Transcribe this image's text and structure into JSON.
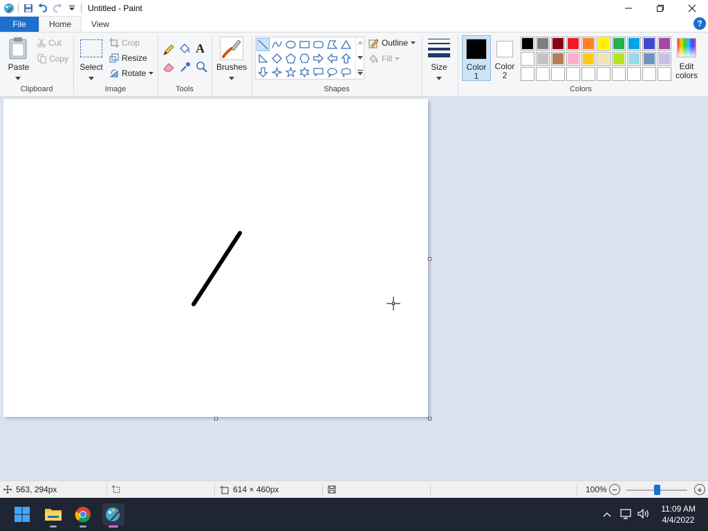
{
  "window": {
    "title": "Untitled - Paint"
  },
  "tabs": [
    {
      "label": "File"
    },
    {
      "label": "Home"
    },
    {
      "label": "View"
    }
  ],
  "help": {
    "label": "?"
  },
  "clipboard": {
    "group_label": "Clipboard",
    "paste_label": "Paste",
    "cut_label": "Cut",
    "copy_label": "Copy"
  },
  "image": {
    "group_label": "Image",
    "select_label": "Select",
    "crop_label": "Crop",
    "resize_label": "Resize",
    "rotate_label": "Rotate"
  },
  "tools": {
    "group_label": "Tools",
    "text_tool_glyph": "A"
  },
  "brushes": {
    "label": "Brushes"
  },
  "shapes": {
    "group_label": "Shapes",
    "outline_label": "Outline",
    "fill_label": "Fill",
    "selected": "line"
  },
  "size": {
    "label": "Size"
  },
  "colors": {
    "group_label": "Colors",
    "color1_label": "Color",
    "color1_num": "1",
    "color2_label": "Color",
    "color2_num": "2",
    "color1_value": "#000000",
    "color2_value": "#ffffff",
    "edit_label": "Edit",
    "edit_label2": "colors",
    "palette_row1": [
      "#000000",
      "#7f7f7f",
      "#880015",
      "#ed1c24",
      "#ff7f27",
      "#fff200",
      "#22b14c",
      "#00a2e8",
      "#3f48cc",
      "#a349a4"
    ],
    "palette_row2": [
      "#ffffff",
      "#c3c3c3",
      "#b97a57",
      "#ffaec9",
      "#ffc90e",
      "#efe4b0",
      "#b5e61d",
      "#99d9ea",
      "#7092be",
      "#c8bfe7"
    ],
    "palette_row3": [
      "#ffffff",
      "#ffffff",
      "#ffffff",
      "#ffffff",
      "#ffffff",
      "#ffffff",
      "#ffffff",
      "#ffffff",
      "#ffffff",
      "#ffffff"
    ]
  },
  "status": {
    "cursor_position": "563, 294px",
    "canvas_size": "614 × 460px",
    "zoom": "100%",
    "zoom_minus": "−",
    "zoom_plus": "+",
    "zoom_level_fraction": 0.5
  },
  "taskbar": {
    "apps": [
      "start-button",
      "file-explorer",
      "chrome",
      "paint"
    ],
    "time": "11:09 AM",
    "date": "4/4/2022"
  }
}
